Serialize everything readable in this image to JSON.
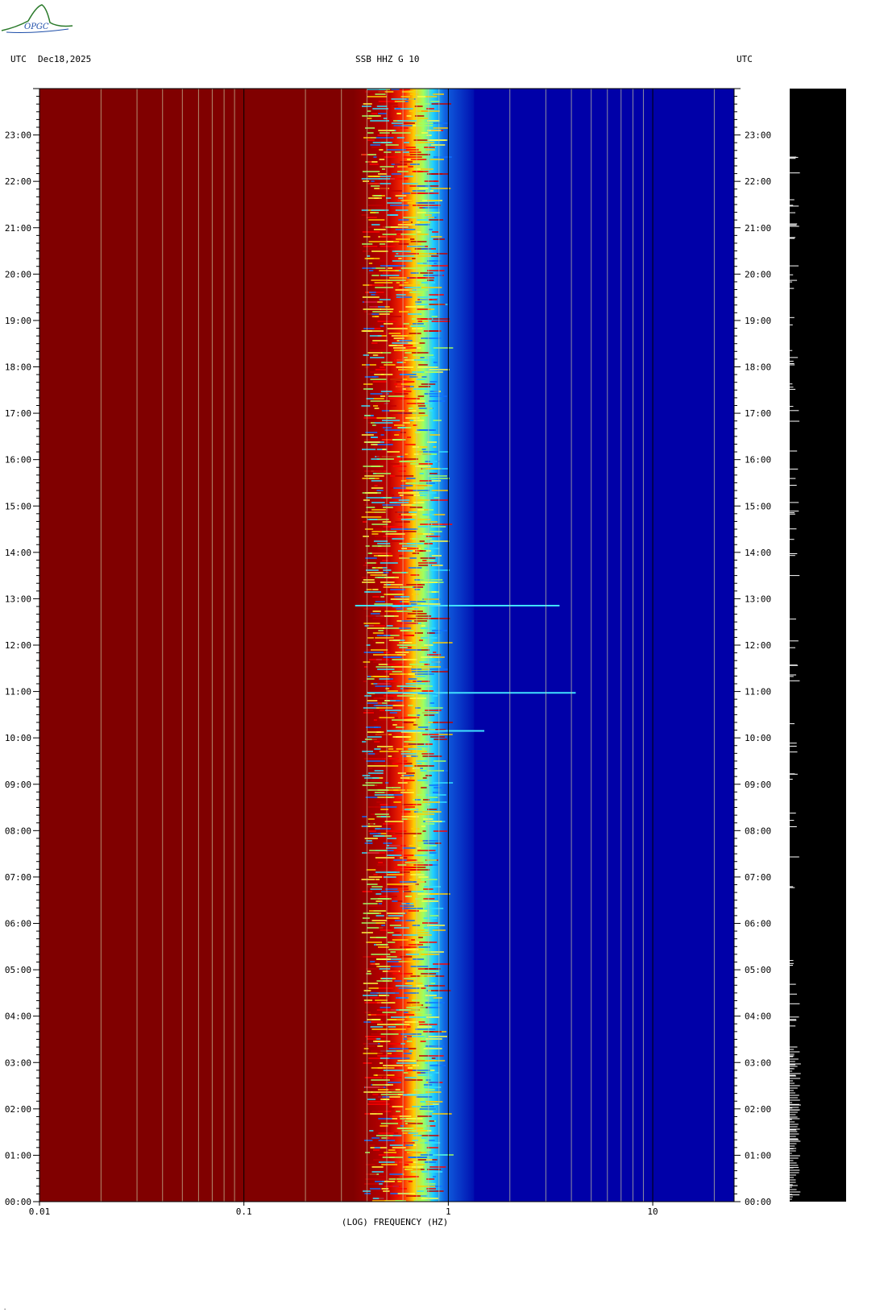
{
  "header": {
    "left_tz": "UTC",
    "date": "Dec18,2025",
    "station": "SSB HHZ G 10",
    "right_tz": "UTC"
  },
  "logo": {
    "text": "OPGC"
  },
  "colors": {
    "low": "#800000",
    "high": "#0000a8",
    "trace_panel": "#000000",
    "grid_light": "#c8c8a0",
    "grid_dark": "#000000"
  },
  "chart_data": {
    "type": "heatmap",
    "title": "SSB HHZ G 10",
    "xlabel": "(LOG) FREQUENCY (HZ)",
    "ylabel": "",
    "xscale": "log",
    "xlim": [
      0.01,
      25
    ],
    "ylim_hours": [
      0,
      24
    ],
    "x_ticks": [
      {
        "value": 0.01,
        "label": "0.01"
      },
      {
        "value": 0.1,
        "label": "0.1"
      },
      {
        "value": 1,
        "label": "1"
      },
      {
        "value": 10,
        "label": "10"
      }
    ],
    "y_ticks": [
      {
        "value": 0,
        "label": "00:00"
      },
      {
        "value": 1,
        "label": "01:00"
      },
      {
        "value": 2,
        "label": "02:00"
      },
      {
        "value": 3,
        "label": "03:00"
      },
      {
        "value": 4,
        "label": "04:00"
      },
      {
        "value": 5,
        "label": "05:00"
      },
      {
        "value": 6,
        "label": "06:00"
      },
      {
        "value": 7,
        "label": "07:00"
      },
      {
        "value": 8,
        "label": "08:00"
      },
      {
        "value": 9,
        "label": "09:00"
      },
      {
        "value": 10,
        "label": "10:00"
      },
      {
        "value": 11,
        "label": "11:00"
      },
      {
        "value": 12,
        "label": "12:00"
      },
      {
        "value": 13,
        "label": "13:00"
      },
      {
        "value": 14,
        "label": "14:00"
      },
      {
        "value": 15,
        "label": "15:00"
      },
      {
        "value": 16,
        "label": "16:00"
      },
      {
        "value": 17,
        "label": "17:00"
      },
      {
        "value": 18,
        "label": "18:00"
      },
      {
        "value": 19,
        "label": "19:00"
      },
      {
        "value": 20,
        "label": "20:00"
      },
      {
        "value": 21,
        "label": "21:00"
      },
      {
        "value": 22,
        "label": "22:00"
      },
      {
        "value": 23,
        "label": "23:00"
      }
    ],
    "transition_frequency_hz": 0.45,
    "events": [
      {
        "hour": 12.85,
        "fmin": 0.35,
        "fmax": 3.5
      },
      {
        "hour": 10.97,
        "fmin": 0.4,
        "fmax": 4.2
      },
      {
        "hour": 10.15,
        "fmin": 0.5,
        "fmax": 1.5
      },
      {
        "hour": 2.3,
        "fmin": 0.6,
        "fmax": 0.8
      }
    ],
    "grid_lines_hz": [
      0.02,
      0.03,
      0.04,
      0.05,
      0.06,
      0.07,
      0.08,
      0.09,
      0.2,
      0.3,
      0.4,
      0.5,
      0.6,
      0.7,
      0.8,
      0.9,
      2,
      3,
      4,
      5,
      6,
      7,
      8,
      9,
      20
    ],
    "major_lines_hz": [
      0.1,
      1,
      10
    ]
  }
}
